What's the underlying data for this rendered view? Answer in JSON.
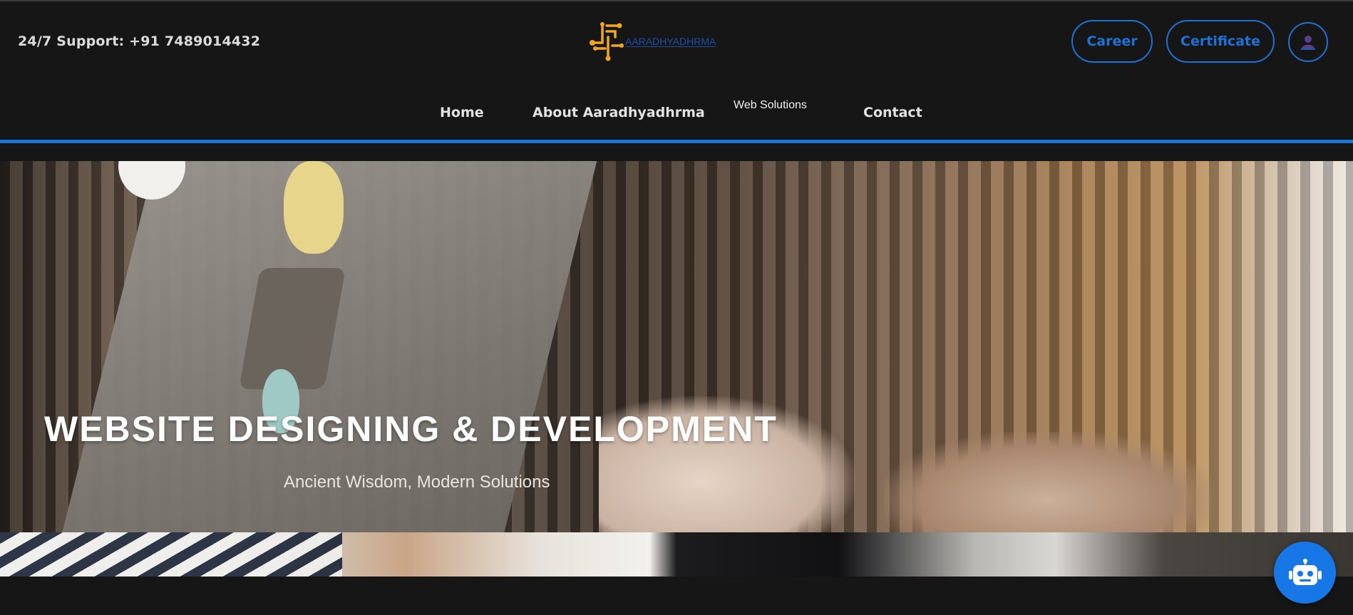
{
  "header": {
    "support_text": "24/7 Support: +91 7489014432",
    "logo_text": "AARADHYADHRMA",
    "career_label": "Career",
    "certificate_label": "Certificate"
  },
  "nav": {
    "items": [
      {
        "label": "Home"
      },
      {
        "label": "About Aaradhyadhrma"
      },
      {
        "label": "Web Solutions"
      },
      {
        "label": "Contact"
      }
    ]
  },
  "hero": {
    "title": "WEBSITE DESIGNING & DEVELOPMENT",
    "subtitle": "Ancient Wisdom, Modern Solutions"
  },
  "colors": {
    "background": "#161616",
    "accent": "#1d72d8",
    "logo_gold": "#f0a623"
  },
  "icons": {
    "user": "user-icon",
    "chatbot": "robot-icon"
  }
}
